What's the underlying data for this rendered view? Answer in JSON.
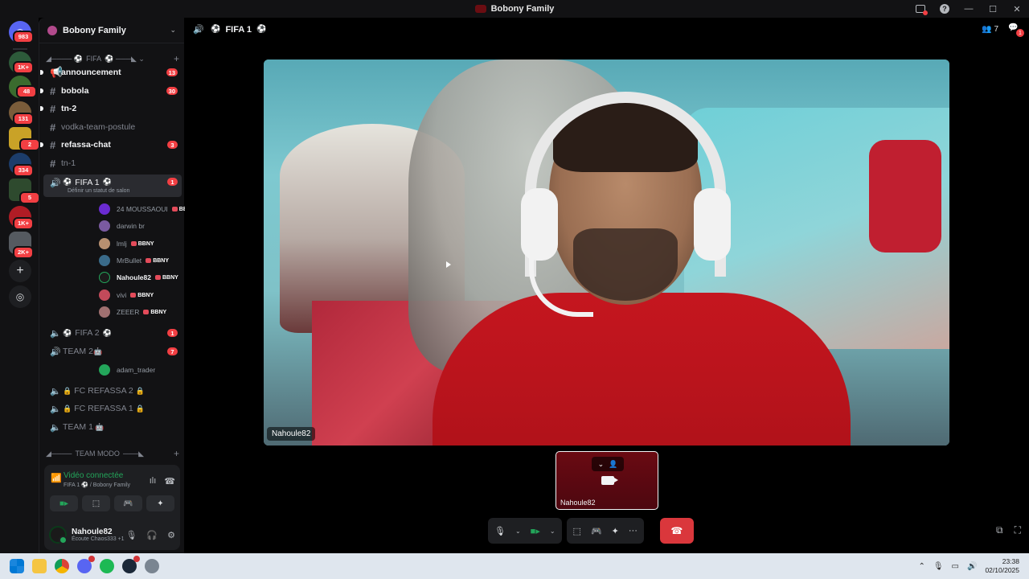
{
  "window": {
    "title": "Bobony Family"
  },
  "rail": {
    "items": [
      {
        "badge": "983",
        "color": "#5865f2"
      },
      {
        "badge": "1K+",
        "color": "#2d5a3a"
      },
      {
        "badge": "48",
        "color": "#3a6b2e"
      },
      {
        "badge": "131",
        "color": "#7a5c3a"
      },
      {
        "badge": "2",
        "color": "#c9a227"
      },
      {
        "badge": "334",
        "color": "#1c3d6b"
      },
      {
        "badge": "5",
        "color": "#2e4a2e"
      },
      {
        "badge": "1K+",
        "color": "#b01c25"
      },
      {
        "badge": "2K+",
        "color": "#555a60"
      }
    ]
  },
  "server": {
    "name": "Bobony Family"
  },
  "categories": {
    "fifa": "FIFA",
    "team_modo": "TEAM MODO"
  },
  "channels": [
    {
      "name": "announcement",
      "badge": "13",
      "state": "unread",
      "icon": "announcement-icon"
    },
    {
      "name": "bobola",
      "badge": "30",
      "state": "unread",
      "icon": "hash-icon"
    },
    {
      "name": "tn-2",
      "badge": "",
      "state": "unread",
      "icon": "hash-icon"
    },
    {
      "name": "vodka-team-postule",
      "badge": "",
      "state": "muted",
      "icon": "hash-icon"
    },
    {
      "name": "refassa-chat",
      "badge": "3",
      "state": "unread",
      "icon": "hash-icon"
    },
    {
      "name": "tn-1",
      "badge": "",
      "state": "muted",
      "icon": "hash-icon"
    }
  ],
  "active_voice": {
    "name": "FIFA 1",
    "badge": "1",
    "status": "Définir un statut de salon"
  },
  "voice_members": [
    {
      "name": "24 MOUSSAOUI",
      "tag": "BBNY",
      "color": "#6a2bd1"
    },
    {
      "name": "darwin br",
      "tag": "",
      "color": "#7a5aa0"
    },
    {
      "name": "lmlj",
      "tag": "BBNY",
      "color": "#b89070"
    },
    {
      "name": "MrBullet",
      "tag": "BBNY",
      "color": "#3a6b8a"
    },
    {
      "name": "Nahoule82",
      "tag": "BBNY",
      "color": "#1b1b1b"
    },
    {
      "name": "vivi",
      "tag": "BBNY",
      "color": "#c24a5a"
    },
    {
      "name": "ZEEER",
      "tag": "BBNY",
      "color": "#a07070"
    }
  ],
  "voice_channels": [
    {
      "name": "FIFA 2",
      "badge": "1"
    },
    {
      "name": "TEAM 2",
      "badge": "7"
    }
  ],
  "team2_member": {
    "name": "adam_trader"
  },
  "locked_channels": [
    {
      "name": "FC REFASSA 2"
    },
    {
      "name": "FC REFASSA 1"
    },
    {
      "name": "TEAM 1"
    }
  ],
  "voice_panel": {
    "title": "Vidéo connectée",
    "sub_channel": "FIFA 1",
    "sub_server": "/ Bobony Family"
  },
  "user": {
    "name": "Nahoule82",
    "activity": "Écoute Chaos333 +1"
  },
  "main": {
    "channel": "FIFA 1",
    "members_count": "7",
    "notif_count": "1",
    "video_label": "Nahoule82",
    "self_label": "Nahoule82"
  },
  "clock": {
    "time": "23:38",
    "date": "02/10/2025"
  }
}
